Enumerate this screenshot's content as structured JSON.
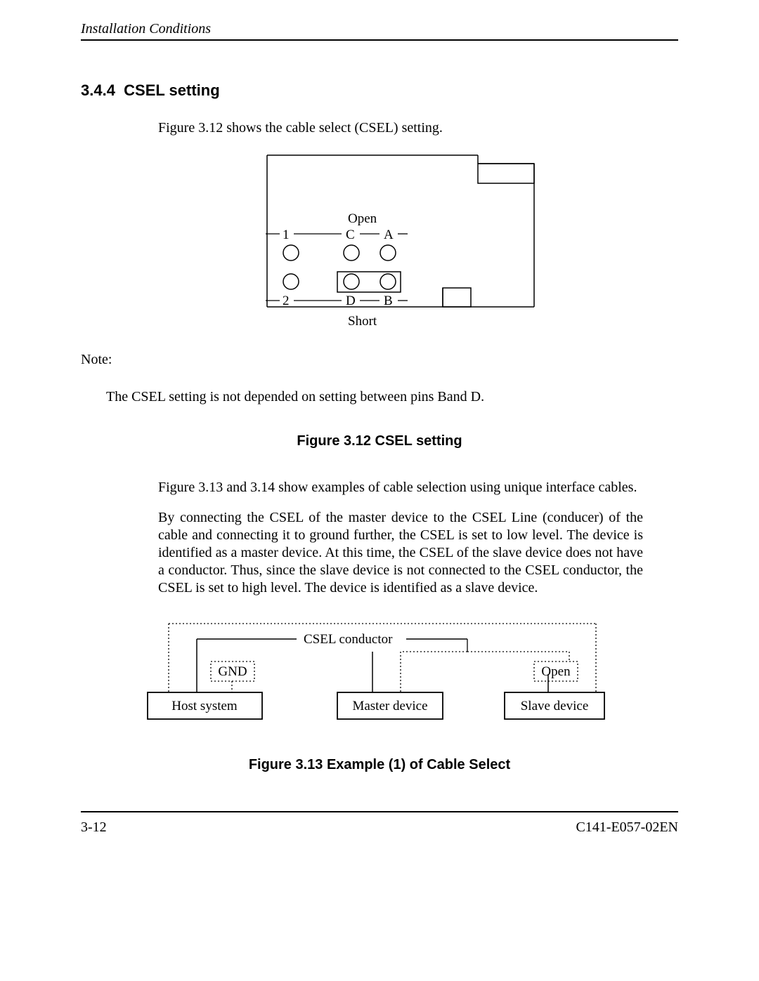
{
  "header": {
    "left": "Installation Conditions"
  },
  "section": {
    "number": "3.4.4",
    "title": "CSEL setting"
  },
  "intro": "Figure 3.12 shows the cable select (CSEL) setting.",
  "diagram1": {
    "label_open": "Open",
    "label_1": "1",
    "label_C": "C",
    "label_A": "A",
    "label_2": "2",
    "label_D": "D",
    "label_B": "B",
    "label_short": "Short"
  },
  "note_label": "Note:",
  "note_text": "The CSEL setting is not depended on setting between pins Band D.",
  "figure1_caption": "Figure 3.12  CSEL setting",
  "para1": "Figure 3.13 and 3.14 show examples of cable selection using unique interface cables.",
  "para2": "By connecting the CSEL of the master device to the CSEL Line (conducer) of the cable and connecting it to ground further, the CSEL is set to low level.  The device is identified as a master device.  At this time, the CSEL of the slave device does not have a conductor.  Thus, since the slave device is not connected to the CSEL conductor, the CSEL is set to high level.  The device is identified as a slave device.",
  "diagram2": {
    "csel_conductor": "CSEL conductor",
    "gnd": "GND",
    "open": "Open",
    "host": "Host system",
    "master": "Master device",
    "slave": "Slave device"
  },
  "figure2_caption": "Figure 3.13  Example (1) of Cable Select",
  "footer": {
    "left": "3-12",
    "right": "C141-E057-02EN"
  }
}
